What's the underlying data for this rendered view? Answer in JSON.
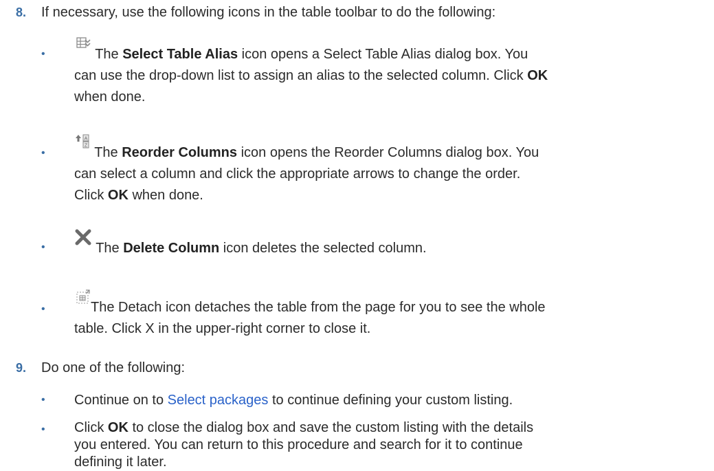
{
  "step8": {
    "number": "8.",
    "text": "If necessary, use the following icons in the table toolbar to do the following:",
    "bullets": [
      {
        "icon": "select-table-alias-icon",
        "pre": " The ",
        "bold": "Select Table Alias",
        "line1_after": " icon opens a Select Table Alias dialog box. You",
        "line2_pre": "can use the drop-down list to assign an alias to the selected column. Click ",
        "line2_bold": "OK",
        "line3": "when done."
      },
      {
        "icon": "reorder-columns-icon",
        "pre": " The ",
        "bold": "Reorder Columns",
        "line1_after": " icon opens the Reorder Columns dialog box. You",
        "line2": "can select a column and click the appropriate arrows to change the order.",
        "line3_pre": "Click ",
        "line3_bold": "OK",
        "line3_after": " when done."
      },
      {
        "icon": "delete-column-icon",
        "pre": " The ",
        "bold": "Delete Column",
        "line1_after": " icon deletes the selected column."
      },
      {
        "icon": "detach-icon",
        "line1": "The Detach icon detaches the table from the page for you to see the whole",
        "line2": "table. Click X in the upper-right corner to close it."
      }
    ]
  },
  "step9": {
    "number": "9.",
    "text": "Do one of the following:",
    "bullets": [
      {
        "pre": "Continue on to ",
        "link": "Select packages",
        "after": " to continue defining your custom listing."
      },
      {
        "pre": "Click ",
        "bold": "OK",
        "line1_after": " to close the dialog box and save the custom listing with the details",
        "line2": "you entered. You can return to this procedure and search for it to continue",
        "line3": "defining it later."
      }
    ]
  },
  "bullet_char": "•",
  "colors": {
    "accent": "#3a6ea5",
    "link": "#2a62c9",
    "text": "#2b2b2b"
  }
}
